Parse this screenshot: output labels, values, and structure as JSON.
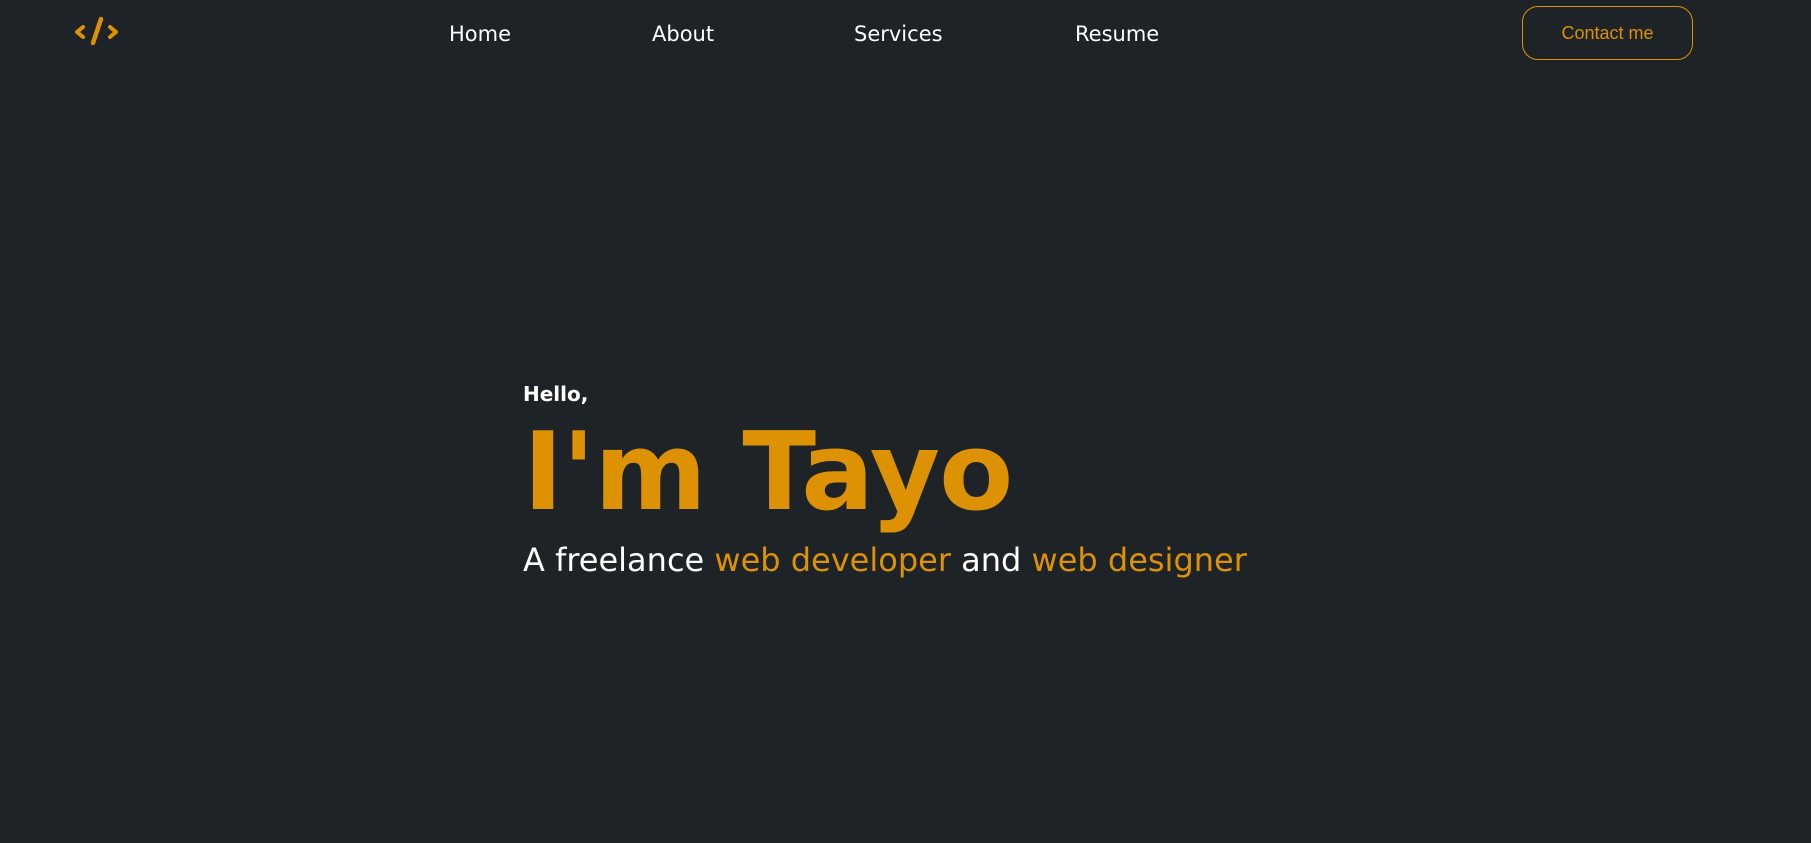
{
  "colors": {
    "background": "#1d2326",
    "accent": "#dc9203",
    "text": "#ffffff"
  },
  "logo": {
    "icon": "code-slash-icon",
    "glyph": "</>"
  },
  "nav": {
    "items": [
      {
        "label": "Home"
      },
      {
        "label": "About"
      },
      {
        "label": "Services"
      },
      {
        "label": "Resume"
      }
    ]
  },
  "contact": {
    "label": "Contact me"
  },
  "hero": {
    "greeting": "Hello,",
    "name": "I'm Tayo",
    "tagline": {
      "prefix": "A freelance ",
      "role_1": "web developer",
      "joiner": " and ",
      "role_2": "web designer"
    }
  }
}
